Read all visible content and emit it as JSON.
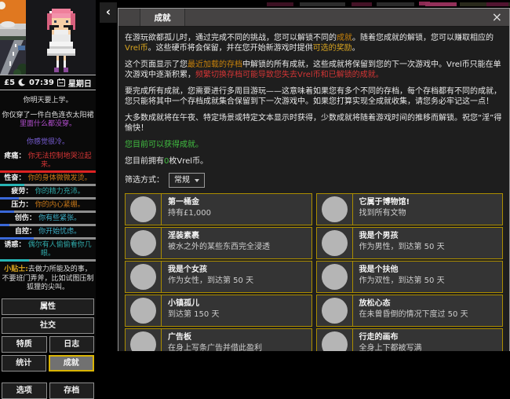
{
  "colors": {
    "normal": "#eaeaea",
    "light": "#dcdcdc",
    "gold": "#c8820a",
    "yellow": "#d9a520",
    "red": "#d43535",
    "green": "#41bf41",
    "purple": "#b44fd0",
    "violet": "#7a5fd8",
    "orange": "#c87818",
    "teal": "#2fa8a8",
    "cyan": "#3fb4cc",
    "bar_red": "#dd2222",
    "bar_teal": "#28b5b5",
    "bar_blue": "#3a68d8",
    "card_border": "#ab8d00"
  },
  "sidebar": {
    "money": "£5",
    "time": "07:39",
    "day": "星期日",
    "notice": "你明天要上学。",
    "clothing": [
      {
        "t": "你仅穿了一件白色连衣太阳裙",
        "c": "light"
      },
      {
        "t": "里面什么都没穿。",
        "c": "purple"
      }
    ],
    "feeling": "你感觉很冷。",
    "stats": [
      {
        "label": "疼痛：",
        "value": "你无法控制地哭泣起来。",
        "value_color": "red",
        "bar_color": "bar_red",
        "bar_pct": 100
      },
      {
        "label": "性奋：",
        "value": "你的身体微微发烫。",
        "value_color": "orange",
        "bar_color": "bar_teal",
        "bar_pct": 25
      },
      {
        "label": "疲劳：",
        "value": "你的精力充沛。",
        "value_color": "teal",
        "bar_color": "bar_blue",
        "bar_pct": 20
      },
      {
        "label": "压力：",
        "value": "你的内心紧绷。",
        "value_color": "orange",
        "bar_color": "bar_blue",
        "bar_pct": 15
      },
      {
        "label": "创伤：",
        "value": "你有些紧张。",
        "value_color": "cyan",
        "bar_color": "bar_blue",
        "bar_pct": 10
      },
      {
        "label": "自控：",
        "value": "你开始忧虑。",
        "value_color": "cyan",
        "bar_color": "bar_blue",
        "bar_pct": 35
      },
      {
        "label": "诱惑：",
        "value": "偶尔有人偷偷看你几眼。",
        "value_color": "teal",
        "bar_color": "bar_teal",
        "bar_pct": 30
      }
    ],
    "tip_label": "小贴士:",
    "tip_text": "去做力所能及的事，不要班门弄斧，比如试图压制狐狸的尖叫。",
    "buttons": {
      "attributes": "属性",
      "social": "社交",
      "traits": "特质",
      "journal": "日志",
      "statistics": "统计",
      "achievements": "成就",
      "options": "选项",
      "saves": "存档"
    },
    "collapse_icon": "‹"
  },
  "dialog": {
    "tab": "成就",
    "close": "×",
    "paragraphs": [
      [
        {
          "t": "在游玩欲都孤儿时，通过完成不同的挑战，您可以解锁不同的",
          "c": "normal"
        },
        {
          "t": "成就",
          "c": "gold"
        },
        {
          "t": "。随着您成就的解锁，您可以赚取相应的",
          "c": "normal"
        },
        {
          "t": "Vrel币",
          "c": "yellow"
        },
        {
          "t": "。这些硬币将会保留，并在您开始新游戏时提供",
          "c": "normal"
        },
        {
          "t": "可选的奖励",
          "c": "yellow"
        },
        {
          "t": "。",
          "c": "normal"
        }
      ],
      [
        {
          "t": "这个页面显示了您",
          "c": "normal"
        },
        {
          "t": "最近加载的存档",
          "c": "gold"
        },
        {
          "t": "中解锁的所有成就，这些成就将保留到您的下一次游戏中。Vrel币只能在单次游戏中逐渐积累，",
          "c": "normal"
        },
        {
          "t": "频繁切换存档可能导致您失去Vrel币和已解锁的成就。",
          "c": "red"
        }
      ],
      [
        {
          "t": "要完成所有成就，您需要进行多周目游玩——这意味着如果您有多个不同的存档，每个存档都有不同的成就，您只能将其中一个存档成就集合保留到下一次游戏中。如果您打算实现全成就收集，请您务必牢记这一点！",
          "c": "normal"
        }
      ],
      [
        {
          "t": "大多数成就将在午夜、特定场景或特定文本显示时获得，少数成就将随着游戏时间的推移而解锁。祝您“淫”得愉快！",
          "c": "normal"
        }
      ]
    ],
    "eligible": "您目前可以获得成就。",
    "coins": [
      {
        "t": "您目前拥有",
        "c": "normal"
      },
      {
        "t": "0",
        "c": "green"
      },
      {
        "t": "枚Vrel币。",
        "c": "normal"
      }
    ],
    "filter_label": "筛选方式：",
    "filter_value": "常规",
    "achievements": [
      {
        "title": "第一桶金",
        "desc": "持有£1,000"
      },
      {
        "title": "它属于博物馆!",
        "desc": "找到所有文物"
      },
      {
        "title": "淫装素裹",
        "desc": "被水之外的某些东西完全浸透"
      },
      {
        "title": "我是个男孩",
        "desc": "作为男性，到达第 50 天"
      },
      {
        "title": "我是个女孩",
        "desc": "作为女性，到达第 50 天"
      },
      {
        "title": "我是个扶他",
        "desc": "作为双性，到达第 50 天"
      },
      {
        "title": "小镇孤儿",
        "desc": "到达第 150 天"
      },
      {
        "title": "放松心态",
        "desc": "在未曾昏倒的情况下度过 50 天"
      },
      {
        "title": "广告板",
        "desc": "在身上写条广告并借此盈利"
      },
      {
        "title": "行走的画布",
        "desc": "全身上下都被写满"
      }
    ]
  }
}
